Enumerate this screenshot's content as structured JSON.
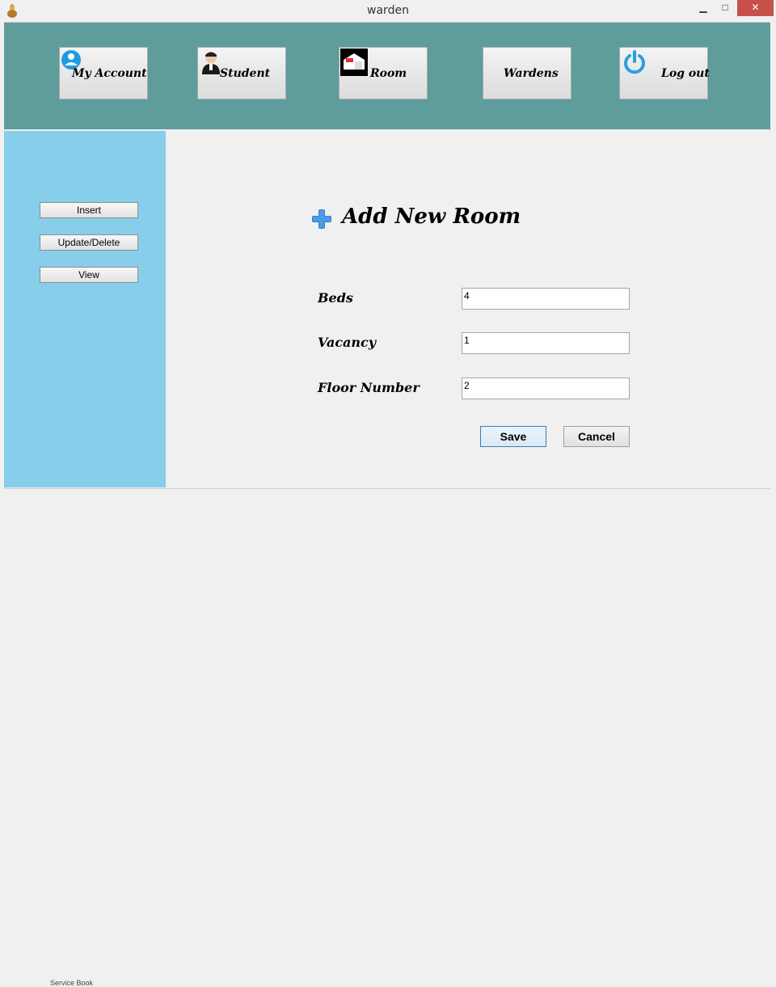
{
  "window": {
    "title": "warden",
    "controls": {
      "minimize": "▁",
      "maximize": "□",
      "close": "✕"
    }
  },
  "nav": {
    "items": [
      {
        "label": "My Account",
        "icon": "account-icon"
      },
      {
        "label": "Student",
        "icon": "student-icon"
      },
      {
        "label": "Room",
        "icon": "room-icon"
      },
      {
        "label": "Wardens",
        "icon": ""
      },
      {
        "label": "Log out",
        "icon": "power-icon"
      }
    ],
    "bg_color": "#5f9c9c"
  },
  "sidebar": {
    "bg_color": "#87ceeb",
    "buttons": [
      {
        "label": "Insert"
      },
      {
        "label": "Update/Delete"
      },
      {
        "label": "View"
      }
    ]
  },
  "form": {
    "heading": "Add New Room",
    "fields": [
      {
        "label": "Beds",
        "value": "4"
      },
      {
        "label": "Vacancy",
        "value": "1"
      },
      {
        "label": "Floor Number",
        "value": "2"
      }
    ],
    "save_label": "Save",
    "cancel_label": "Cancel"
  },
  "taskbar_hint": "Service Book"
}
